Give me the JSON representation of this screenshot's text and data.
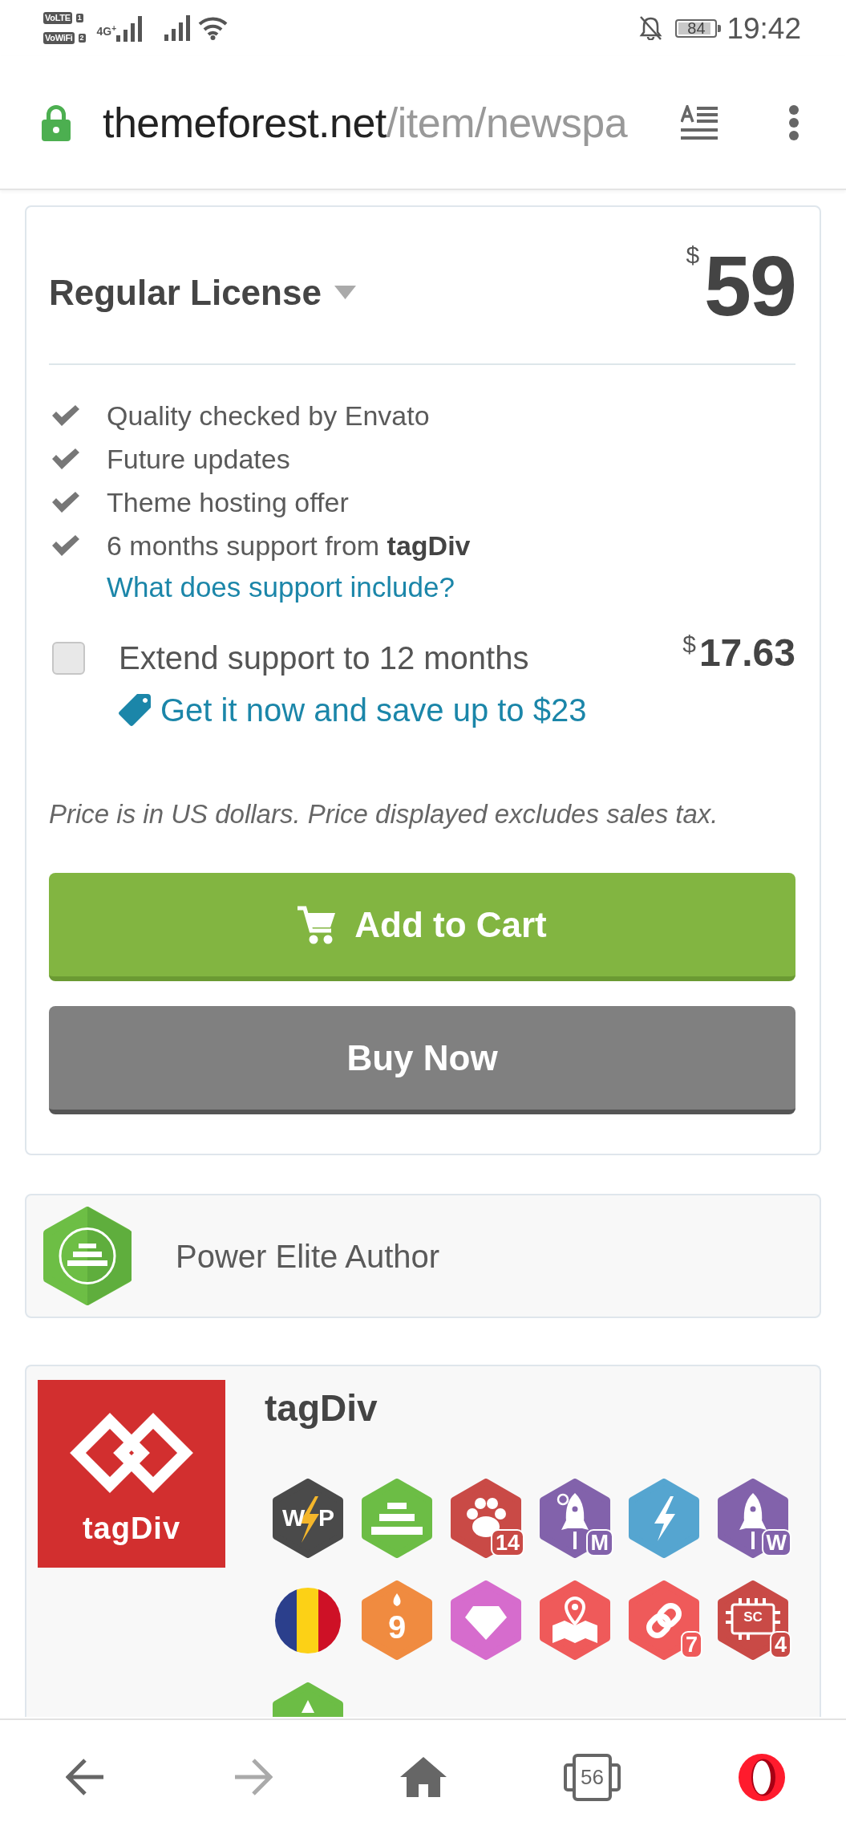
{
  "status_bar": {
    "sims": [
      {
        "network": "VoLTE",
        "slot": "1"
      },
      {
        "network": "VoWiFi",
        "slot": "2"
      }
    ],
    "network_type": "4G$^{+}$",
    "battery": "84",
    "time": "19:42"
  },
  "address_bar": {
    "domain": "themeforest.net",
    "path": "/item/newspa"
  },
  "license_card": {
    "title": "Regular License",
    "currency": "$",
    "amount": "59",
    "features": [
      "Quality checked by Envato",
      "Future updates",
      "Theme hosting offer",
      "6 months support from **tagDiv**"
    ],
    "support_link": "What does support include?",
    "extend": {
      "checked": false,
      "label": "Extend support to 12 months",
      "currency": "$",
      "amount": "17.63",
      "offer": "Get it now and save up to $23"
    },
    "note": "Price is in US dollars. Price displayed excludes sales tax.",
    "buttons": [
      {
        "kind": "cart",
        "label": "Add to Cart"
      },
      {
        "kind": "buy",
        "label": "Buy Now"
      }
    ]
  },
  "author_level": {
    "label": "Power Elite Author"
  },
  "author": {
    "logo_text": "tagDiv",
    "name": "tagDiv",
    "badges": [
      {
        "kind": "bolt-letters",
        "color": "#4a4a4a",
        "labels": [
          "W",
          "P"
        ],
        "partial": false
      },
      {
        "kind": "steps",
        "color": "#6cbd45",
        "partial": false
      },
      {
        "kind": "paw",
        "color": "#c94a46",
        "labels": [
          "14"
        ],
        "partial": false
      },
      {
        "kind": "rocket-moon",
        "color": "#8262ab",
        "labels": [
          "M"
        ],
        "partial": false
      },
      {
        "kind": "bolt",
        "color": "#55a5d0",
        "partial": false
      },
      {
        "kind": "rocket",
        "color": "#8262ab",
        "labels": [
          "W"
        ],
        "partial": false
      },
      {
        "kind": "flag",
        "partial": false
      },
      {
        "kind": "candle",
        "color": "#f08b40",
        "labels": [
          "9"
        ],
        "partial": false
      },
      {
        "kind": "diamond",
        "color": "#d66ccd",
        "partial": false
      },
      {
        "kind": "map",
        "color": "#ef5a5a",
        "partial": false
      },
      {
        "kind": "link",
        "color": "#ef5a5a",
        "labels": [
          "7"
        ],
        "partial": false
      },
      {
        "kind": "chip",
        "color": "#c94a46",
        "labels": [
          "SC",
          "4"
        ],
        "partial": false
      },
      {
        "kind": "peak",
        "color": "#6cbd45",
        "partial": true
      }
    ]
  },
  "nav_bar": [
    {
      "kind": "back",
      "disabled": false
    },
    {
      "kind": "forward",
      "disabled": true
    },
    {
      "kind": "home",
      "disabled": false
    },
    {
      "kind": "tabs",
      "count": "56",
      "disabled": false
    },
    {
      "kind": "menu",
      "disabled": false
    }
  ]
}
